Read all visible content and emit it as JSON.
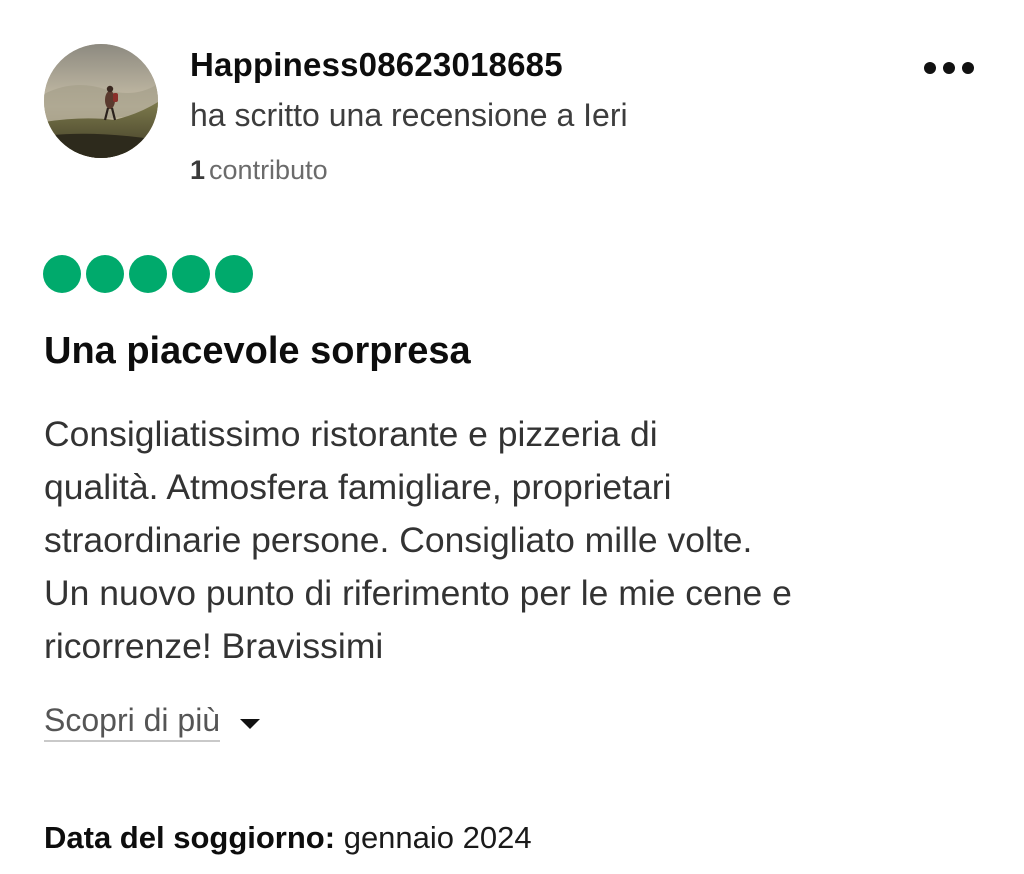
{
  "reviewer": {
    "name": "Happiness08623018685",
    "activity": "ha scritto una recensione a Ieri",
    "contributions_count": "1",
    "contributions_label": "contributo",
    "avatar_icon": "hiker-landscape-photo"
  },
  "menu": {
    "more_icon": "ellipsis-icon"
  },
  "rating": {
    "value": 5,
    "max": 5,
    "color": "#00aa6c"
  },
  "review": {
    "title": "Una piacevole sorpresa",
    "body_lines": [
      "Consigliatissimo ristorante e pizzeria di",
      "qualità. Atmosfera famigliare, proprietari",
      "straordinarie persone. Consigliato mille volte.",
      "Un nuovo punto di riferimento per le mie cene e",
      "ricorrenze! Bravissimi"
    ],
    "read_more_label": "Scopri di più"
  },
  "stay": {
    "label": "Data del soggiorno:",
    "value": "gennaio 2024"
  }
}
